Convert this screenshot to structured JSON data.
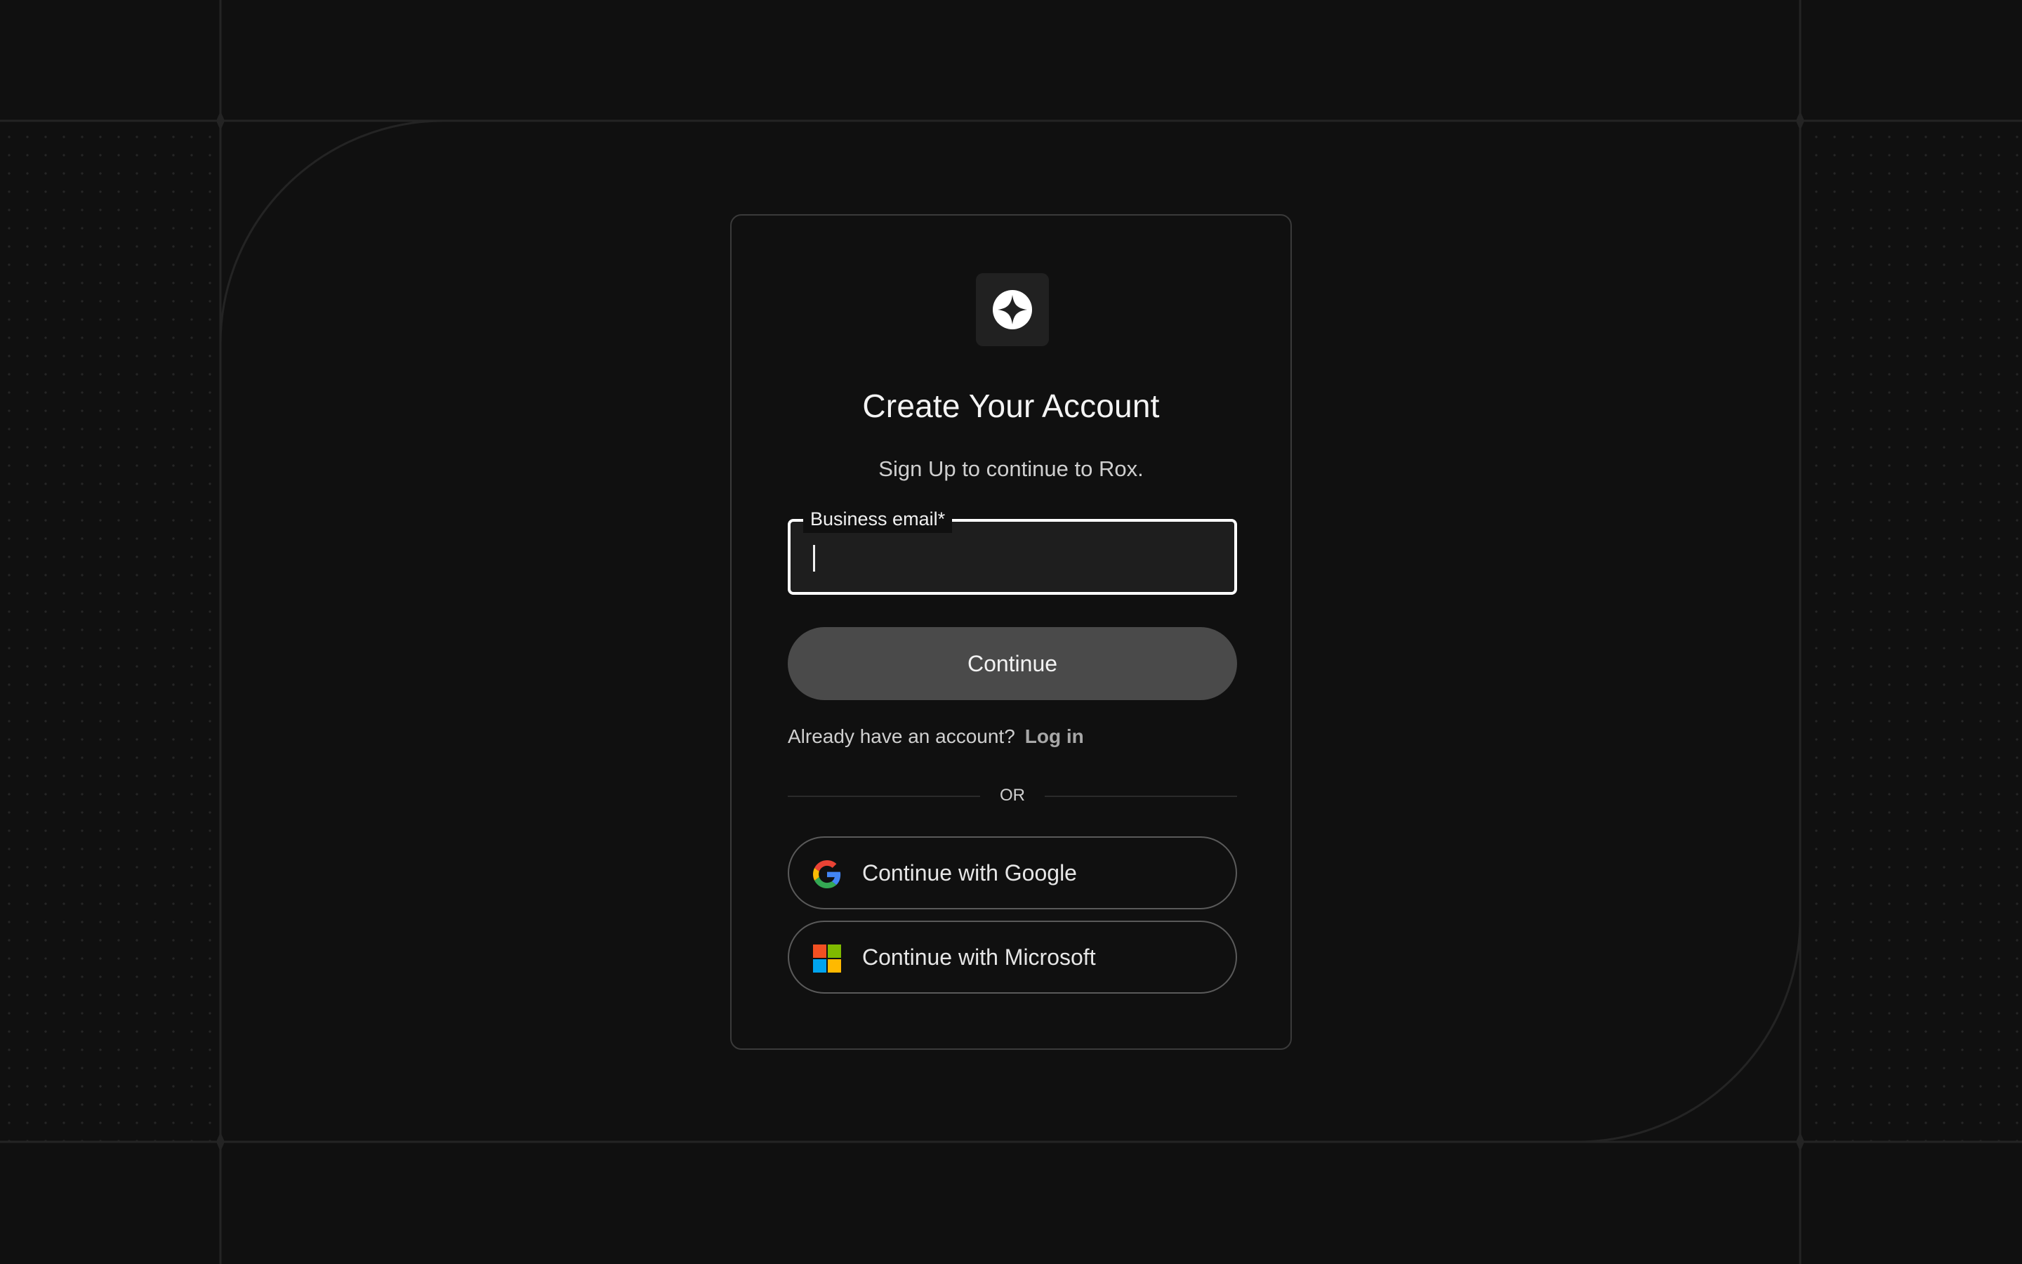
{
  "signup": {
    "title": "Create Your Account",
    "subtitle": "Sign Up to continue to Rox.",
    "email": {
      "label": "Business email",
      "required_marker": "*",
      "value": ""
    },
    "continue_label": "Continue",
    "login_prompt": "Already have an account?",
    "login_link": "Log in",
    "divider_text": "OR",
    "google_label": "Continue with Google",
    "microsoft_label": "Continue with Microsoft"
  },
  "icons": {
    "logo": "rox-star-logo-icon",
    "google": "google-icon",
    "microsoft": "microsoft-icon"
  },
  "colors": {
    "background": "#101010",
    "card_border": "#3a3a3a",
    "continue_button": "#4a4a4a",
    "input_focus_border": "#ffffff",
    "microsoft_red": "#F25022",
    "microsoft_green": "#7FBA00",
    "microsoft_blue": "#00A4EF",
    "microsoft_yellow": "#FFB900",
    "google_blue": "#4285F4",
    "google_red": "#EA4335",
    "google_yellow": "#FBBC05",
    "google_green": "#34A853"
  }
}
